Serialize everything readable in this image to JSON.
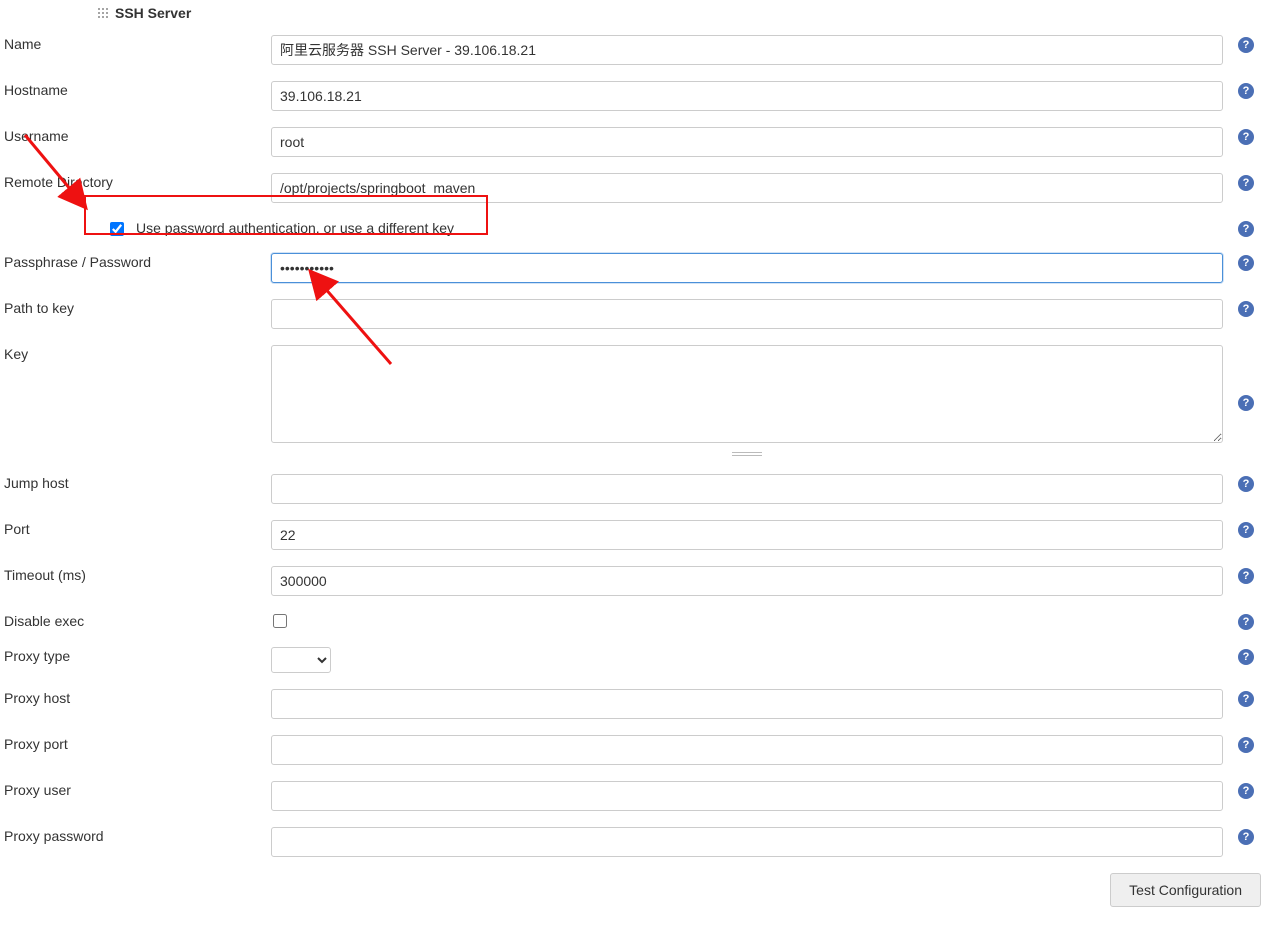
{
  "section_title": "SSH Server",
  "fields": {
    "name": {
      "label": "Name",
      "value": "阿里云服务器 SSH Server - 39.106.18.21"
    },
    "hostname": {
      "label": "Hostname",
      "value": "39.106.18.21"
    },
    "username": {
      "label": "Username",
      "value": "root"
    },
    "remote_dir": {
      "label": "Remote Directory",
      "value": "/opt/projects/springboot_maven"
    },
    "use_password": {
      "label": "Use password authentication, or use a different key",
      "checked": true
    },
    "passphrase": {
      "label": "Passphrase / Password",
      "value": "•••••••••••"
    },
    "path_to_key": {
      "label": "Path to key",
      "value": ""
    },
    "key": {
      "label": "Key",
      "value": ""
    },
    "jump_host": {
      "label": "Jump host",
      "value": ""
    },
    "port": {
      "label": "Port",
      "value": "22"
    },
    "timeout": {
      "label": "Timeout (ms)",
      "value": "300000"
    },
    "disable_exec": {
      "label": "Disable exec",
      "checked": false
    },
    "proxy_type": {
      "label": "Proxy type",
      "value": ""
    },
    "proxy_host": {
      "label": "Proxy host",
      "value": ""
    },
    "proxy_port": {
      "label": "Proxy port",
      "value": ""
    },
    "proxy_user": {
      "label": "Proxy user",
      "value": ""
    },
    "proxy_password": {
      "label": "Proxy password",
      "value": ""
    }
  },
  "buttons": {
    "test_configuration": "Test Configuration"
  },
  "icons": {
    "help": "?"
  }
}
